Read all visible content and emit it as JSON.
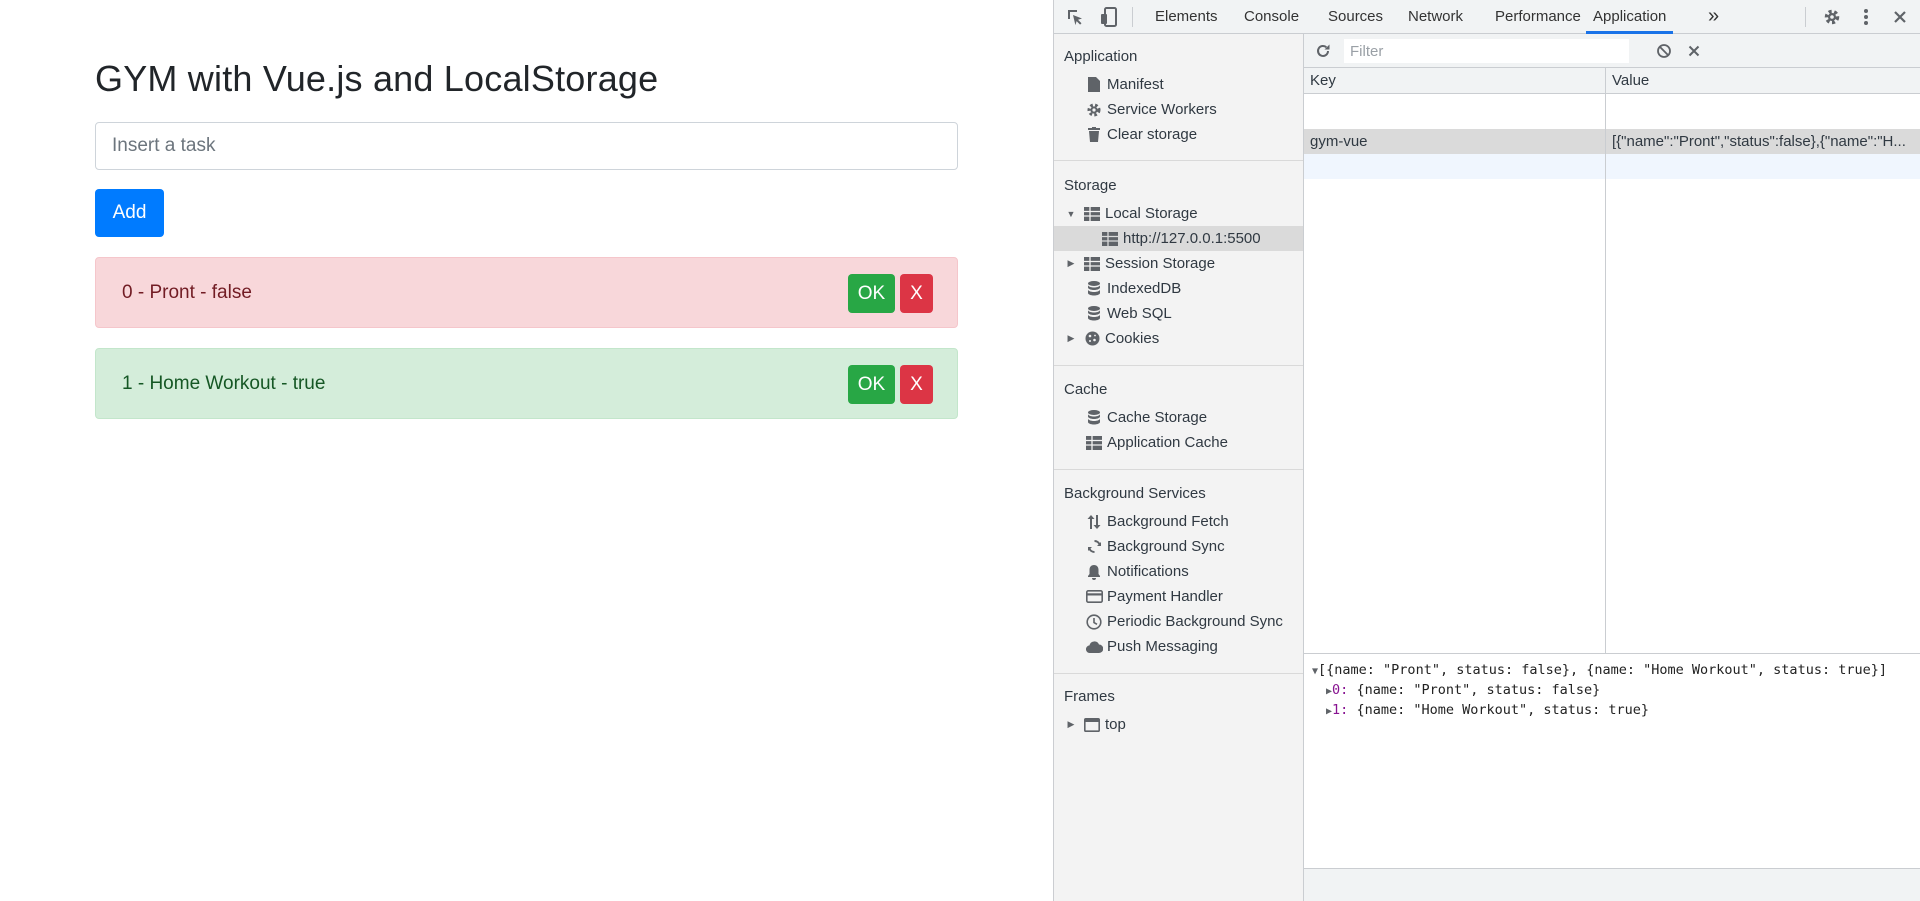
{
  "page": {
    "title": "GYM with Vue.js and LocalStorage",
    "input_placeholder": "Insert a task",
    "add_label": "Add",
    "tasks": [
      {
        "label": "0 - Pront - false",
        "ok": "OK",
        "remove": "X",
        "status_color": "#f8d7da"
      },
      {
        "label": "1 - Home Workout - true",
        "ok": "OK",
        "remove": "X",
        "status_color": "#d4edda"
      }
    ]
  },
  "devtools": {
    "toolbar": {
      "tabs": [
        "Elements",
        "Console",
        "Sources",
        "Network",
        "Performance",
        "Application"
      ],
      "active_tab": "Application",
      "more": "»"
    },
    "sidebar": {
      "sections": {
        "application": {
          "heading": "Application",
          "items": [
            "Manifest",
            "Service Workers",
            "Clear storage"
          ]
        },
        "storage": {
          "heading": "Storage",
          "items": [
            "Local Storage",
            "http://127.0.0.1:5500",
            "Session Storage",
            "IndexedDB",
            "Web SQL",
            "Cookies"
          ]
        },
        "cache": {
          "heading": "Cache",
          "items": [
            "Cache Storage",
            "Application Cache"
          ]
        },
        "background": {
          "heading": "Background Services",
          "items": [
            "Background Fetch",
            "Background Sync",
            "Notifications",
            "Payment Handler",
            "Periodic Background Sync",
            "Push Messaging"
          ]
        },
        "frames": {
          "heading": "Frames",
          "items": [
            "top"
          ]
        }
      }
    },
    "main": {
      "filter_placeholder": "Filter",
      "columns": {
        "key": "Key",
        "value": "Value"
      },
      "rows": [
        {
          "key": "gym-vue",
          "value": "[{\"name\":\"Pront\",\"status\":false},{\"name\":\"H..."
        }
      ],
      "preview": {
        "root": "[{name: \"Pront\", status: false}, {name: \"Home Workout\", status: true}]",
        "items": [
          {
            "index": "0",
            "text": "{name: \"Pront\", status: false}"
          },
          {
            "index": "1",
            "text": "{name: \"Home Workout\", status: true}"
          }
        ]
      }
    }
  },
  "colors": {
    "primary": "#007bff",
    "success": "#28a745",
    "danger": "#dc3545",
    "devtools_accent": "#1a73e8"
  }
}
